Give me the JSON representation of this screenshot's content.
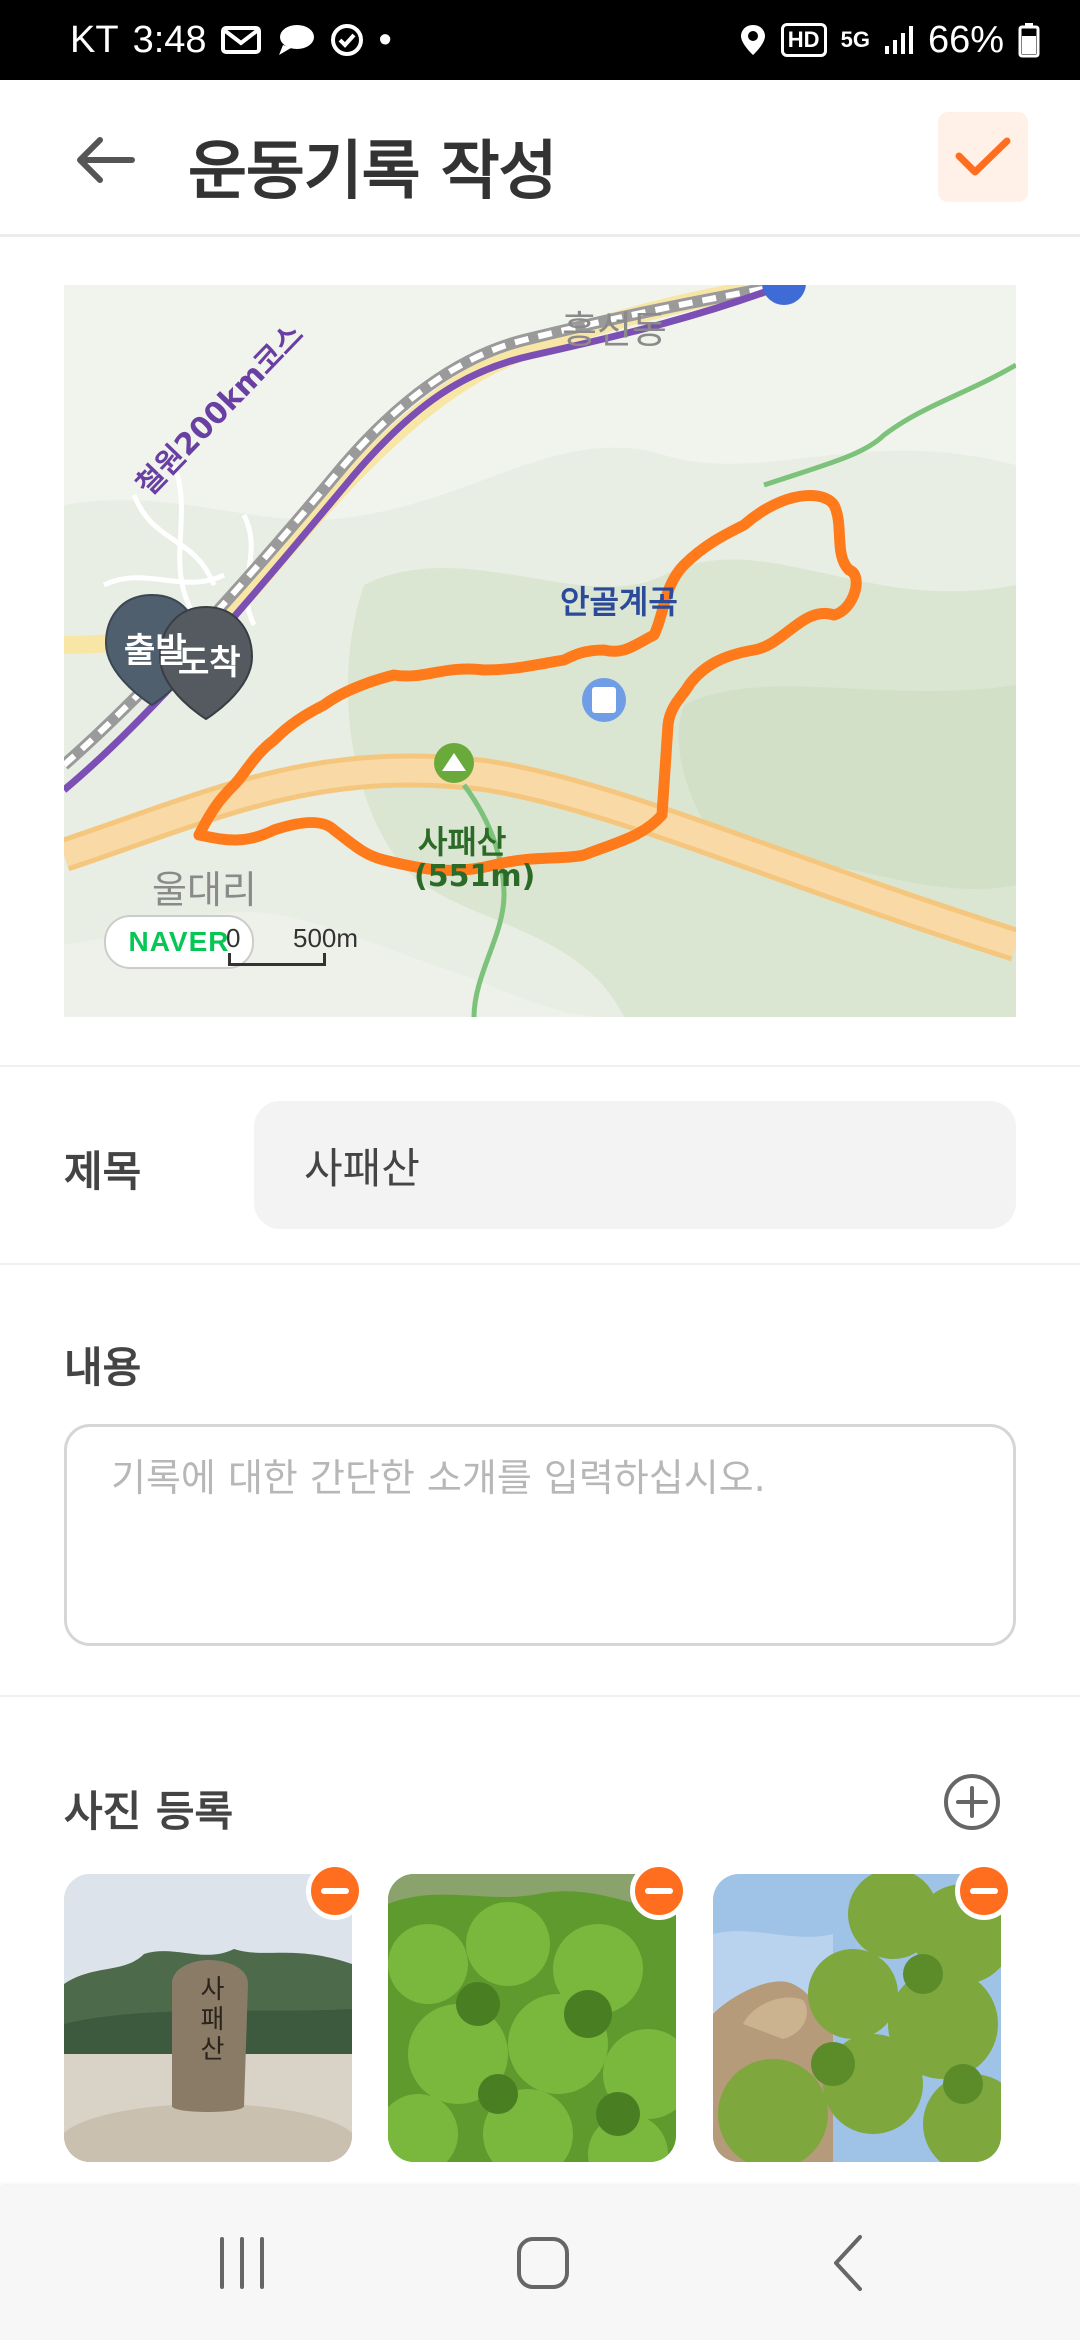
{
  "status_bar": {
    "carrier": "KT",
    "time": "3:48",
    "dot": "•",
    "hd": "HD",
    "network": "5G",
    "battery": "66%"
  },
  "header": {
    "title": "운동기록 작성",
    "back_icon": "arrow-left-icon",
    "confirm_icon": "checkmark-icon",
    "accent_color": "#ff6e1f"
  },
  "map": {
    "places": {
      "heungseon": "흥선동",
      "anggol": "안골계곡",
      "uldae": "울대리",
      "sapae_name": "사패산",
      "sapae_height": "(551m)",
      "route": "철원200km코스"
    },
    "markers": {
      "start": "출발",
      "end": "도착"
    },
    "brand": "NAVER",
    "scale_start": "0",
    "scale_end": "500m",
    "route_color": "#ff7a1a"
  },
  "form": {
    "title_label": "제목",
    "title_value": "사패산",
    "content_label": "내용",
    "content_placeholder": "기록에 대한 간단한 소개를 입력하십시오.",
    "photos_label": "사진 등록",
    "add_icon": "plus-circle-icon",
    "remove_icon": "minus-circle-icon",
    "photo_stone_text": "사패산"
  },
  "nav_bar": {
    "recents_icon": "recents-icon",
    "home_icon": "home-icon",
    "back_icon": "back-chevron-icon"
  }
}
